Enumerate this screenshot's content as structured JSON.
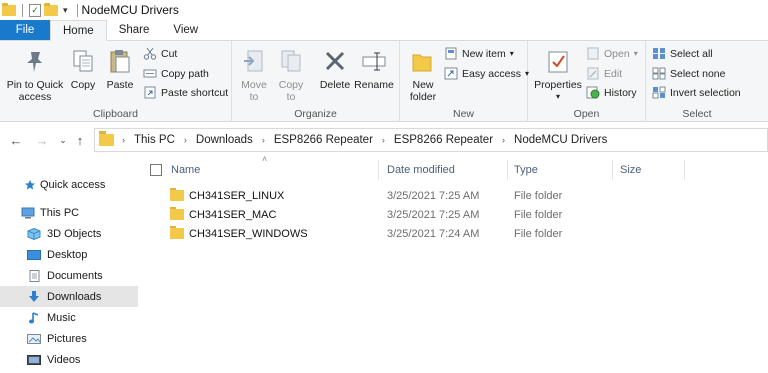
{
  "window": {
    "title": "NodeMCU Drivers",
    "quick_access_dropdown": "▾"
  },
  "tabs": [
    {
      "label": "File"
    },
    {
      "label": "Home"
    },
    {
      "label": "Share"
    },
    {
      "label": "View"
    }
  ],
  "ribbon": {
    "clipboard": {
      "label": "Clipboard",
      "pin": "Pin to Quick access",
      "pin_l1": "Pin to Quick",
      "pin_l2": "access",
      "copy": "Copy",
      "paste": "Paste",
      "cut": "Cut",
      "copy_path": "Copy path",
      "paste_shortcut": "Paste shortcut"
    },
    "organize": {
      "label": "Organize",
      "move_l1": "Move",
      "move_l2": "to",
      "copy_l1": "Copy",
      "copy_l2": "to",
      "delete": "Delete",
      "rename": "Rename"
    },
    "new": {
      "label": "New",
      "folder_l1": "New",
      "folder_l2": "folder",
      "new_item": "New item",
      "easy_access": "Easy access"
    },
    "open": {
      "label": "Open",
      "properties": "Properties",
      "open": "Open",
      "edit": "Edit",
      "history": "History"
    },
    "select": {
      "label": "Select",
      "select_all": "Select all",
      "select_none": "Select none",
      "invert": "Invert selection"
    }
  },
  "address": {
    "crumbs": [
      "This PC",
      "Downloads",
      "ESP8266 Repeater",
      "ESP8266 Repeater",
      "NodeMCU Drivers"
    ]
  },
  "nav_pane": {
    "quick_access": "Quick access",
    "this_pc": "This PC",
    "items": [
      "3D Objects",
      "Desktop",
      "Documents",
      "Downloads",
      "Music",
      "Pictures",
      "Videos"
    ],
    "selected": "Downloads"
  },
  "file_list": {
    "columns": [
      "Name",
      "Date modified",
      "Type",
      "Size"
    ],
    "rows": [
      {
        "name": "CH341SER_LINUX",
        "date": "3/25/2021 7:25 AM",
        "type": "File folder",
        "size": ""
      },
      {
        "name": "CH341SER_MAC",
        "date": "3/25/2021 7:25 AM",
        "type": "File folder",
        "size": ""
      },
      {
        "name": "CH341SER_WINDOWS",
        "date": "3/25/2021 7:24 AM",
        "type": "File folder",
        "size": ""
      }
    ]
  },
  "colors": {
    "file_tab": "#1979ca",
    "folder": "#f3c94a",
    "ribbon_bg": "#f5f6f7",
    "selected_nav": "#e5e5e5"
  }
}
